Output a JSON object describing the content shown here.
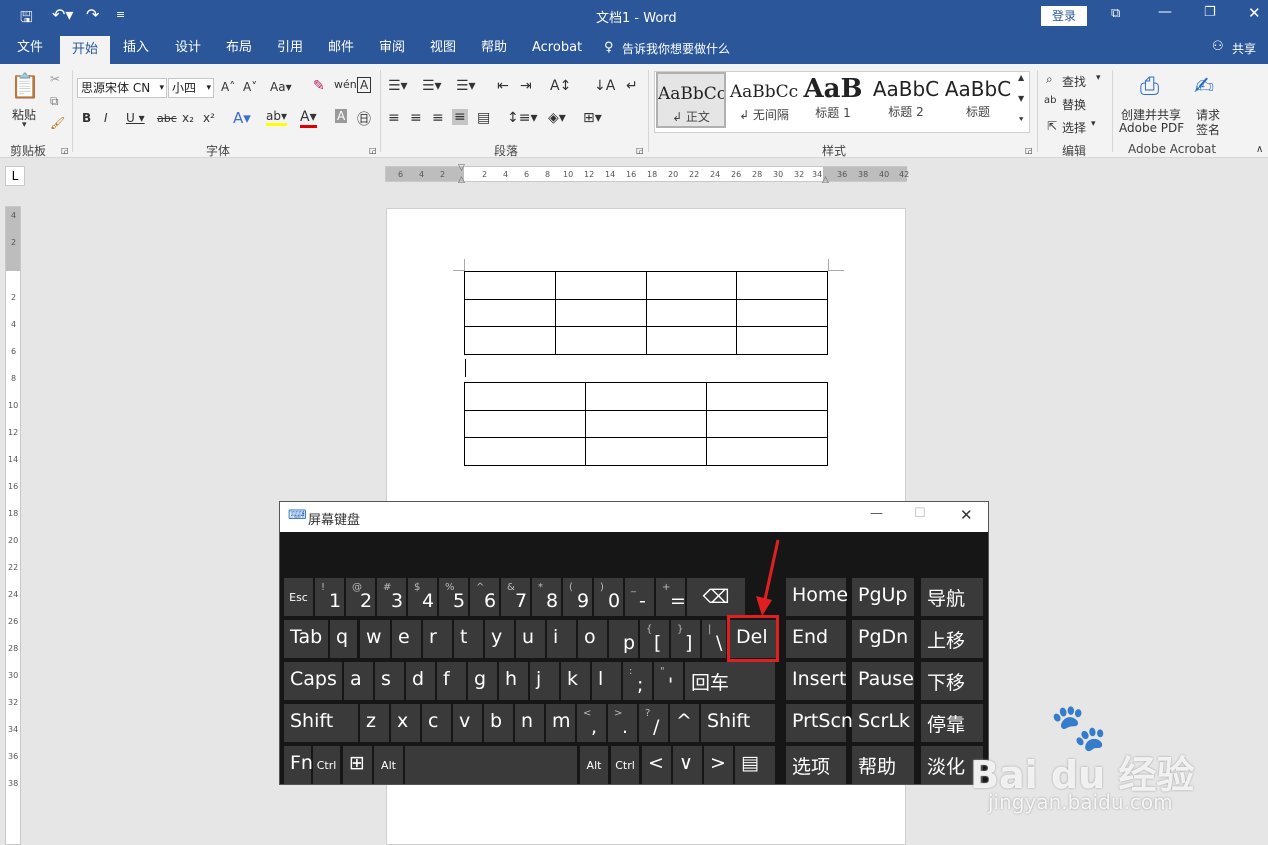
{
  "app": {
    "title": "文档1 - Word",
    "login_label": "登录",
    "share_label": "共享"
  },
  "tabs": [
    "文件",
    "开始",
    "插入",
    "设计",
    "布局",
    "引用",
    "邮件",
    "审阅",
    "视图",
    "帮助",
    "Acrobat"
  ],
  "tell_me": "告诉我你想要做什么",
  "ribbon": {
    "clipboard": {
      "paste_label": "粘贴",
      "group_label": "剪贴板"
    },
    "font": {
      "name": "思源宋体 CN",
      "size": "小四",
      "group_label": "字体"
    },
    "paragraph": {
      "group_label": "段落"
    },
    "styles": {
      "items": [
        {
          "preview": "AaBbCc",
          "name": "↲ 正文"
        },
        {
          "preview": "AaBbCc",
          "name": "↲ 无间隔"
        },
        {
          "preview": "AaB",
          "name": "标题 1"
        },
        {
          "preview": "AaBbC",
          "name": "标题 2"
        },
        {
          "preview": "AaBbC",
          "name": "标题"
        }
      ],
      "group_label": "样式"
    },
    "editing": {
      "find": "查找",
      "replace": "替换",
      "select": "选择",
      "group_label": "编辑"
    },
    "acrobat": {
      "create_line1": "创建并共享",
      "create_line2": "Adobe PDF",
      "sign_line1": "请求",
      "sign_line2": "签名",
      "group_label": "Adobe Acrobat"
    }
  },
  "ruler": {
    "h_ticks": [
      "6",
      "4",
      "2",
      "2",
      "4",
      "6",
      "8",
      "10",
      "12",
      "14",
      "16",
      "18",
      "20",
      "22",
      "24",
      "26",
      "28",
      "30",
      "32",
      "34",
      "36",
      "38",
      "40",
      "42"
    ],
    "v_ticks": [
      "4",
      "2",
      "2",
      "4",
      "6",
      "8",
      "10",
      "12",
      "14",
      "16",
      "18",
      "20",
      "22",
      "24",
      "26",
      "28",
      "30",
      "32",
      "34",
      "36",
      "38"
    ]
  },
  "osk": {
    "title": "屏幕键盘",
    "rows": [
      [
        [
          "Esc",
          ""
        ],
        [
          "1",
          "!"
        ],
        [
          "2",
          "@"
        ],
        [
          "3",
          "#"
        ],
        [
          "4",
          "$"
        ],
        [
          "5",
          "%"
        ],
        [
          "6",
          "^"
        ],
        [
          "7",
          "&"
        ],
        [
          "8",
          "*"
        ],
        [
          "9",
          "("
        ],
        [
          "0",
          ")"
        ],
        [
          "-",
          "_"
        ],
        [
          "=",
          "+"
        ],
        [
          "⌫",
          ""
        ]
      ],
      [
        [
          "Tab",
          ""
        ],
        [
          "q",
          ""
        ],
        [
          "w",
          ""
        ],
        [
          "e",
          ""
        ],
        [
          "r",
          ""
        ],
        [
          "t",
          ""
        ],
        [
          "y",
          ""
        ],
        [
          "u",
          ""
        ],
        [
          "i",
          ""
        ],
        [
          "o",
          ""
        ],
        [
          "p",
          ""
        ],
        [
          "[",
          "{"
        ],
        [
          "]",
          "}"
        ],
        [
          "\\",
          "|"
        ],
        [
          "Del",
          ""
        ]
      ],
      [
        [
          "Caps",
          ""
        ],
        [
          "a",
          ""
        ],
        [
          "s",
          ""
        ],
        [
          "d",
          ""
        ],
        [
          "f",
          ""
        ],
        [
          "g",
          ""
        ],
        [
          "h",
          ""
        ],
        [
          "j",
          ""
        ],
        [
          "k",
          ""
        ],
        [
          "l",
          ""
        ],
        [
          ";",
          ":"
        ],
        [
          "'",
          "\""
        ],
        [
          "回车",
          ""
        ]
      ],
      [
        [
          "Shift",
          ""
        ],
        [
          "z",
          ""
        ],
        [
          "x",
          ""
        ],
        [
          "c",
          ""
        ],
        [
          "v",
          ""
        ],
        [
          "b",
          ""
        ],
        [
          "n",
          ""
        ],
        [
          "m",
          ""
        ],
        [
          ",",
          "<"
        ],
        [
          ".",
          ">"
        ],
        [
          "/",
          "?"
        ],
        [
          "^",
          ""
        ],
        [
          "Shift",
          ""
        ]
      ],
      [
        [
          "Fn",
          ""
        ],
        [
          "Ctrl",
          ""
        ],
        [
          "⊞",
          ""
        ],
        [
          "Alt",
          ""
        ],
        [
          "",
          ""
        ],
        [
          "Alt",
          ""
        ],
        [
          "Ctrl",
          ""
        ],
        [
          "<",
          ""
        ],
        [
          "∨",
          ""
        ],
        [
          ">",
          ""
        ],
        [
          "▤",
          ""
        ]
      ]
    ],
    "side": [
      [
        "Home",
        "PgUp",
        "导航"
      ],
      [
        "End",
        "PgDn",
        "上移"
      ],
      [
        "Insert",
        "Pause",
        "下移"
      ],
      [
        "PrtScn",
        "ScrLk",
        "停靠"
      ],
      [
        "选项",
        "帮助",
        "淡化"
      ]
    ]
  },
  "watermark": {
    "text": "Bai du 经验",
    "url": "jingyan.baidu.com"
  }
}
